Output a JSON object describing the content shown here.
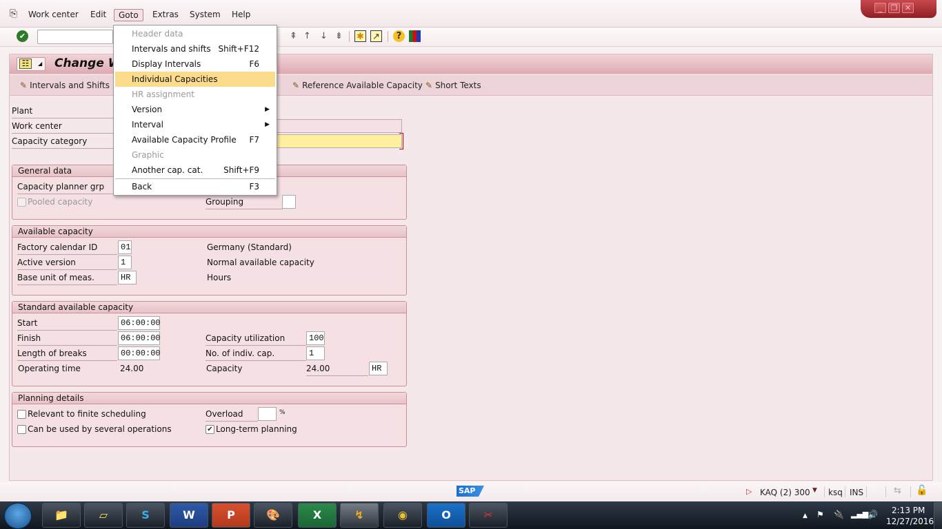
{
  "menubar": {
    "items": [
      "Work center",
      "Edit",
      "Goto",
      "Extras",
      "System",
      "Help"
    ],
    "active": "Goto"
  },
  "window_controls": {
    "minimize": "_",
    "restore": "❐",
    "close": "✕"
  },
  "toolbar": {
    "command_field": {
      "value": "",
      "placeholder": ""
    },
    "icons": [
      "enter-icon",
      "first-page-icon",
      "previous-page-icon",
      "next-page-icon",
      "last-page-icon",
      "create-session-icon",
      "shortcut-icon",
      "help-icon",
      "customize-layout-icon"
    ]
  },
  "app": {
    "title": "Change Work Center Capacity: Header",
    "title_visible": "Change W",
    "toolbar_buttons": [
      "Intervals and Shifts",
      "Reference Available Capacity",
      "Short Texts"
    ]
  },
  "header_fields": {
    "plant": {
      "label": "Plant",
      "value": ""
    },
    "work_center": {
      "label": "Work center",
      "value": ""
    },
    "capacity_category": {
      "label": "Capacity category",
      "value": ""
    }
  },
  "general_data": {
    "title": "General data",
    "capacity_planner_grp": {
      "label": "Capacity planner grp",
      "value": ""
    },
    "pooled_capacity": {
      "label": "Pooled capacity",
      "checked": false,
      "disabled": true
    },
    "grouping": {
      "label": "Grouping",
      "value": ""
    }
  },
  "available_capacity": {
    "title": "Available capacity",
    "factory_calendar_id": {
      "label": "Factory calendar ID",
      "value": "01",
      "desc": "Germany (Standard)"
    },
    "active_version": {
      "label": "Active version",
      "value": "1",
      "desc": "Normal available capacity"
    },
    "base_unit": {
      "label": "Base unit of meas.",
      "value": "HR",
      "desc": "Hours"
    }
  },
  "standard_capacity": {
    "title": "Standard available capacity",
    "start": {
      "label": "Start",
      "value": "06:00:00"
    },
    "finish": {
      "label": "Finish",
      "value": "06:00:00"
    },
    "breaks": {
      "label": "Length of breaks",
      "value": "00:00:00"
    },
    "operating_time": {
      "label": "Operating time",
      "value": "24.00"
    },
    "utilization": {
      "label": "Capacity utilization",
      "value": "100"
    },
    "indiv_cap": {
      "label": "No. of indiv. cap.",
      "value": "1"
    },
    "capacity": {
      "label": "Capacity",
      "value": "24.00",
      "unit": "HR"
    }
  },
  "planning_details": {
    "title": "Planning details",
    "finite_scheduling": {
      "label": "Relevant to finite scheduling",
      "checked": false
    },
    "several_operations": {
      "label": "Can be used by several operations",
      "checked": false
    },
    "overload": {
      "label": "Overload",
      "value": "",
      "unit": "%"
    },
    "long_term": {
      "label": "Long-term planning",
      "checked": true
    }
  },
  "goto_menu": [
    {
      "label": "Header data",
      "shortcut": "",
      "disabled": true
    },
    {
      "label": "Intervals and shifts",
      "shortcut": "Shift+F12",
      "disabled": false
    },
    {
      "label": "Display Intervals",
      "shortcut": "F6",
      "disabled": false
    },
    {
      "label": "Individual Capacities",
      "shortcut": "",
      "disabled": false,
      "highlighted": true
    },
    {
      "label": "HR assignment",
      "shortcut": "",
      "disabled": true
    },
    {
      "label": "Version",
      "shortcut": "",
      "submenu": true
    },
    {
      "label": "Interval",
      "shortcut": "",
      "submenu": true
    },
    {
      "label": "Available Capacity Profile",
      "shortcut": "F7"
    },
    {
      "label": "Graphic",
      "shortcut": "",
      "disabled": true
    },
    {
      "label": "Another cap. cat.",
      "shortcut": "Shift+F9"
    },
    {
      "label": "Back",
      "shortcut": "F3"
    }
  ],
  "statusbar": {
    "logo": "SAP",
    "system": "KAQ (2) 300",
    "server": "ksq",
    "mode": "INS"
  },
  "taskbar": {
    "apps": [
      "File Explorer",
      "Sticky Notes",
      "Skype",
      "Word",
      "PowerPoint",
      "Paint",
      "Excel",
      "SAP Logon",
      "Chrome",
      "Outlook",
      "Snipping Tool"
    ],
    "app_letters": [
      "📁",
      "▱",
      "S",
      "W",
      "P",
      "🎨",
      "X",
      "↯",
      "◉",
      "O",
      "✂"
    ],
    "time": "2:13 PM",
    "date": "12/27/2016"
  },
  "colors": {
    "highlight": "#fbdb8c",
    "required_field": "#fff0a0",
    "title_gradient": "#ddaab2"
  }
}
